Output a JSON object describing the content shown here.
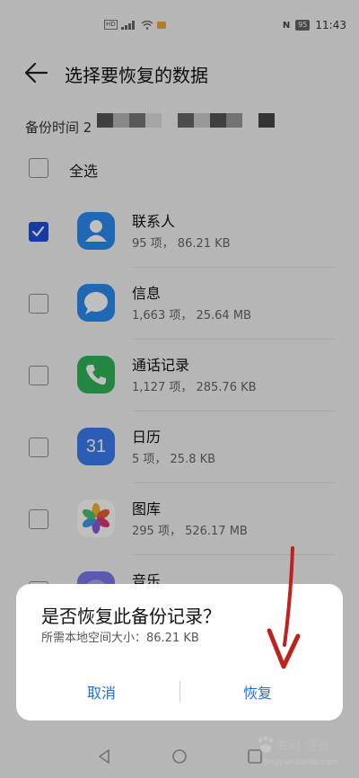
{
  "status_bar": {
    "hd": "HD",
    "time": "11:43",
    "battery": "95",
    "nfc": "N"
  },
  "header": {
    "title": "选择要恢复的数据",
    "back_icon": "arrow-left-icon"
  },
  "backup": {
    "label": "备份时间 2"
  },
  "select_all": {
    "label": "全选",
    "checked": false
  },
  "items": [
    {
      "title": "联系人",
      "subtitle": "95 项， 86.21 KB",
      "checked": true,
      "icon": "contacts-icon"
    },
    {
      "title": "信息",
      "subtitle": "1,663 项， 25.64 MB",
      "checked": false,
      "icon": "messages-icon"
    },
    {
      "title": "通话记录",
      "subtitle": "1,127 项， 285.76 KB",
      "checked": false,
      "icon": "phone-icon"
    },
    {
      "title": "日历",
      "subtitle": "5 项， 25.8 KB",
      "checked": false,
      "icon": "calendar-icon",
      "icon_text": "31"
    },
    {
      "title": "图库",
      "subtitle": "295 项， 526.17 MB",
      "checked": false,
      "icon": "gallery-icon"
    },
    {
      "title": "音乐",
      "subtitle": "",
      "checked": false,
      "icon": "music-icon"
    }
  ],
  "dialog": {
    "title": "是否恢复此备份记录？",
    "message": "所需本地空间大小：86.21 KB",
    "cancel_label": "取消",
    "restore_label": "恢复"
  },
  "watermark": {
    "text": "Bai 经验",
    "sub": "jingyan.baidu.com"
  },
  "colors": {
    "accent": "#1e6fe0",
    "checkbox_checked": "#1e50d8",
    "arrow": "#c0201e"
  }
}
